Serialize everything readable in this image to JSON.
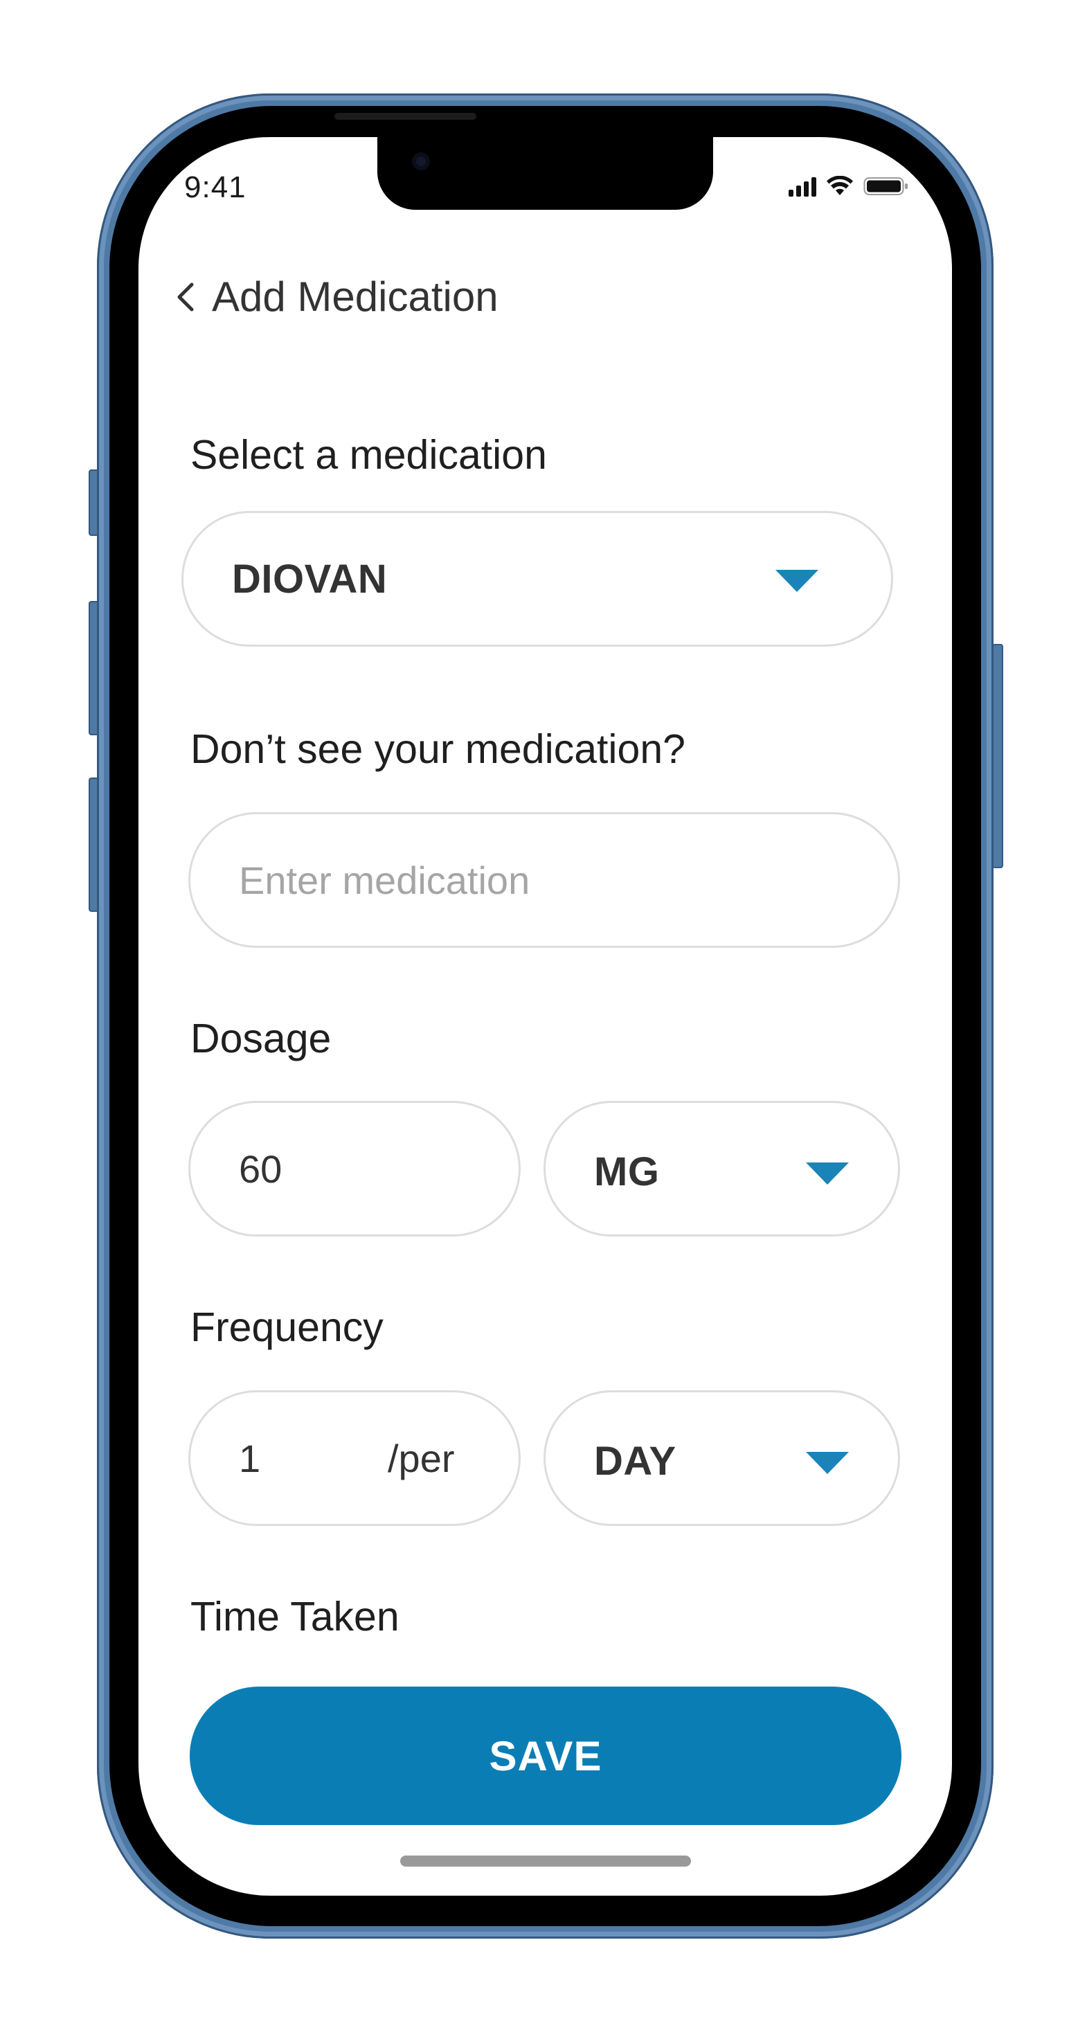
{
  "status_bar": {
    "time": "9:41",
    "signal_icon": "cellular-signal-icon",
    "wifi_icon": "wifi-icon",
    "battery_icon": "battery-icon"
  },
  "header": {
    "back_icon": "chevron-left-icon",
    "title": "Add Medication"
  },
  "form": {
    "medication": {
      "label": "Select a medication",
      "value": "DIOVAN",
      "dropdown_icon": "caret-down-icon"
    },
    "custom_medication": {
      "label": "Don’t see your medication?",
      "value": "",
      "placeholder": "Enter medication"
    },
    "dosage": {
      "label": "Dosage",
      "amount": "60",
      "unit": "MG",
      "dropdown_icon": "caret-down-icon"
    },
    "frequency": {
      "label": "Frequency",
      "count": "1",
      "suffix": "/per",
      "period": "DAY",
      "dropdown_icon": "caret-down-icon"
    },
    "time_taken": {
      "label": "Time Taken"
    }
  },
  "actions": {
    "save_label": "SAVE"
  },
  "colors": {
    "accent": "#0b7db5",
    "caret": "#1a84b8",
    "frame": "#4f7aa6",
    "field_border": "#dddddd",
    "placeholder": "#a5a5a5"
  }
}
